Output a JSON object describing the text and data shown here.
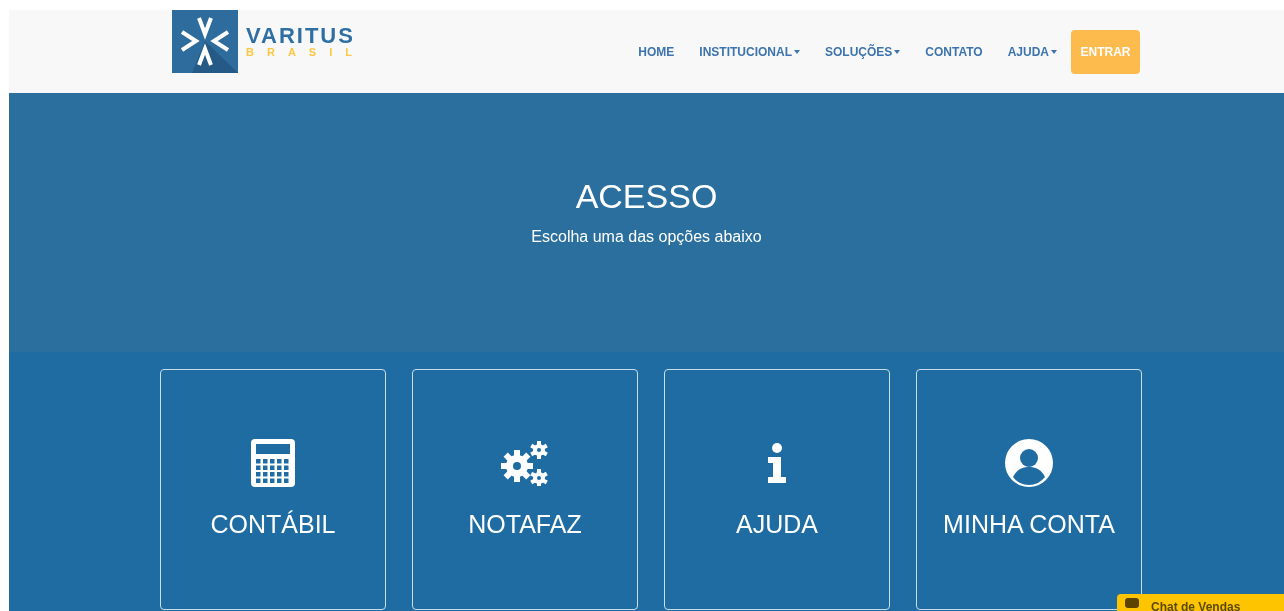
{
  "logo": {
    "name": "VARITUS",
    "subtitle": "BRASIL"
  },
  "nav": [
    {
      "label": "HOME",
      "has_menu": false
    },
    {
      "label": "INSTITUCIONAL",
      "has_menu": true
    },
    {
      "label": "SOLUÇÕES",
      "has_menu": true
    },
    {
      "label": "CONTATO",
      "has_menu": false
    },
    {
      "label": "AJUDA",
      "has_menu": true
    }
  ],
  "login_button": "ENTRAR",
  "hero": {
    "title": "ACESSO",
    "subtitle": "Escolha uma das opções abaixo"
  },
  "cards": [
    {
      "kind": "calculator",
      "label": "CONTÁBIL"
    },
    {
      "kind": "gears",
      "label": "NOTAFAZ"
    },
    {
      "kind": "info",
      "label": "AJUDA"
    },
    {
      "kind": "user",
      "label": "MINHA CONTA"
    }
  ],
  "chat": {
    "label": "Chat de Vendas"
  }
}
